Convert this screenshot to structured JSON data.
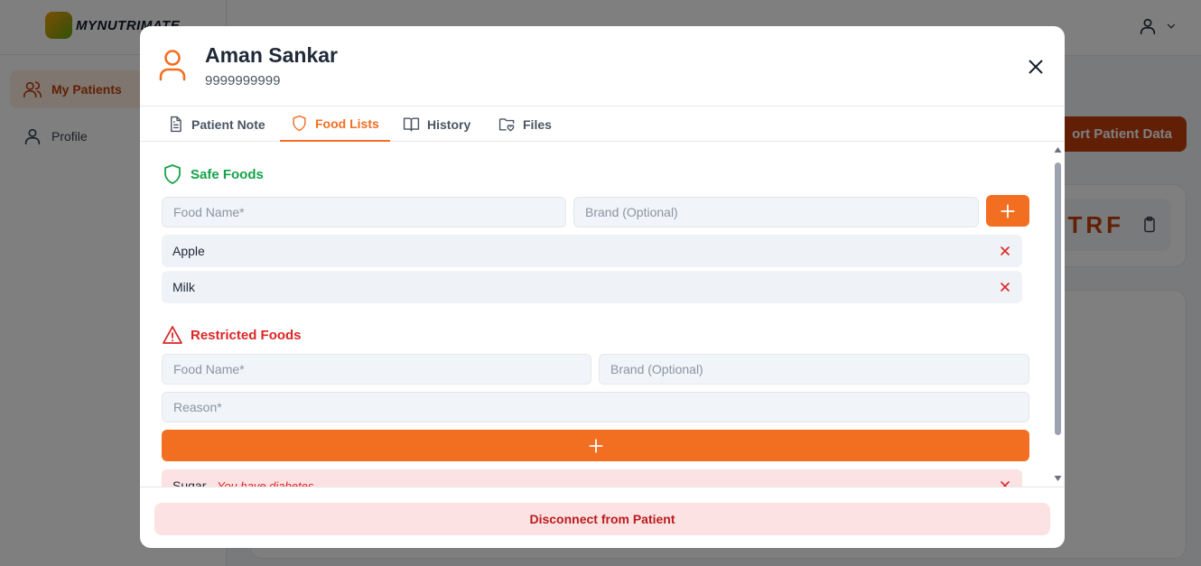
{
  "app": {
    "logo_text": "MYNUTRIMATE",
    "nav": [
      {
        "label": "My Patients",
        "icon": "users-icon",
        "active": true
      },
      {
        "label": "Profile",
        "icon": "user-icon",
        "active": false
      }
    ],
    "export_label": "ort Patient Data",
    "code_text": "TRF"
  },
  "modal": {
    "patient_name": "Aman Sankar",
    "patient_phone": "9999999999",
    "tabs": [
      {
        "label": "Patient Note",
        "icon": "document-icon",
        "active": false
      },
      {
        "label": "Food Lists",
        "icon": "shield-icon",
        "active": true
      },
      {
        "label": "History",
        "icon": "book-icon",
        "active": false
      },
      {
        "label": "Files",
        "icon": "folder-heart-icon",
        "active": false
      }
    ],
    "safe_foods": {
      "title": "Safe Foods",
      "food_placeholder": "Food Name*",
      "brand_placeholder": "Brand (Optional)",
      "items": [
        {
          "name": "Apple"
        },
        {
          "name": "Milk"
        }
      ]
    },
    "restricted_foods": {
      "title": "Restricted Foods",
      "food_placeholder": "Food Name*",
      "brand_placeholder": "Brand (Optional)",
      "reason_placeholder": "Reason*",
      "items": [
        {
          "name": "Sugar",
          "reason": "You have diabetes"
        }
      ]
    },
    "disconnect_label": "Disconnect from Patient"
  },
  "colors": {
    "accent": "#f26f22",
    "safe": "#16a34a",
    "danger": "#dc2626"
  }
}
